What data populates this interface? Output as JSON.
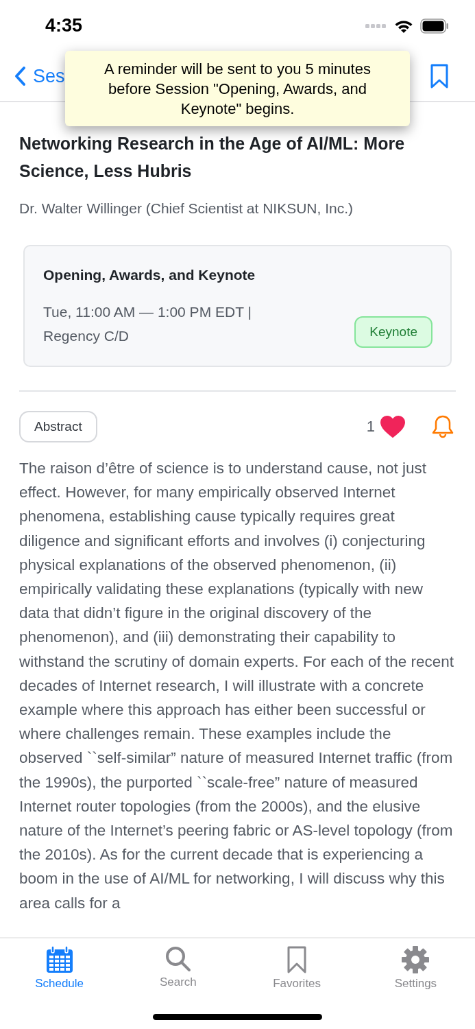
{
  "status_bar": {
    "time": "4:35"
  },
  "nav": {
    "back_label": "Ses",
    "bookmarked": false
  },
  "toast": {
    "message": "A reminder will be sent to you 5 minutes before Session \"Opening, Awards, and Keynote\" begins."
  },
  "talk": {
    "title": "Networking Research in the Age of AI/ML: More Science, Less Hubris",
    "speaker": "Dr. Walter Willinger (Chief Scientist at NIKSUN, Inc.)"
  },
  "session": {
    "title": "Opening, Awards, and Keynote",
    "time": "Tue, 11:00 AM — 1:00 PM EDT |",
    "room": "Regency C/D",
    "tag": "Keynote"
  },
  "actions": {
    "abstract_label": "Abstract",
    "likes": "1",
    "liked": true,
    "reminder": true
  },
  "abstract": "The raison d’être of science is to understand cause, not just effect. However, for many empirically observed Internet phenomena, establishing cause typically requires great diligence and significant efforts and involves (i) conjecturing physical explanations of the observed phenomenon, (ii) empirically validating these explanations (typically with new data that didn’t figure in the original discovery of the phenomenon), and (iii) demonstrating their capability to withstand the scrutiny of domain experts. For each of the recent decades of Internet research, I will illustrate with a concrete example where this approach has either been successful or where challenges remain. These examples include the observed ``self-similar” nature of measured Internet traffic (from the 1990s), the purported ``scale-free” nature of measured Internet router topologies (from the 2000s), and the elusive nature of the Internet’s peering fabric or AS-level topology (from the 2010s). As for the current decade that is experiencing a boom in the use of AI/ML for networking, I will discuss why this area calls for a",
  "tabs": [
    {
      "kind": "calendar",
      "label": "Schedule",
      "selected": true
    },
    {
      "kind": "search",
      "label": "Search",
      "selected": false
    },
    {
      "kind": "bookmark",
      "label": "Favorites",
      "selected": false
    },
    {
      "kind": "gear",
      "label": "Settings",
      "selected": false
    }
  ]
}
